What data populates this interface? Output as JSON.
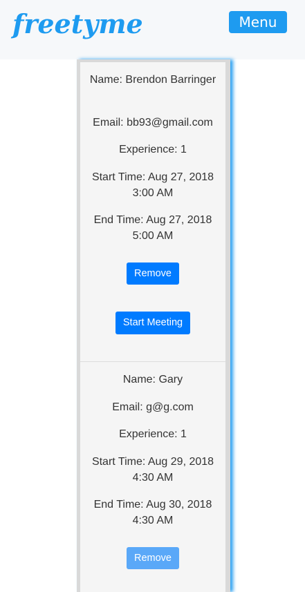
{
  "header": {
    "logo_text": "freetyme",
    "menu_label": "Menu",
    "brand_color": "#1e9bf0"
  },
  "entries": [
    {
      "name": "Name: Brendon Barringer",
      "email": "Email: bb93@gmail.com",
      "experience": "Experience: 1",
      "start_time": "Start Time: Aug 27, 2018 3:00 AM",
      "end_time": "End Time: Aug 27, 2018 5:00 AM",
      "remove_label": "Remove",
      "start_meeting_label": "Start Meeting"
    },
    {
      "name": "Name: Gary",
      "email": "Email: g@g.com",
      "experience": "Experience: 1",
      "start_time": "Start Time: Aug 29, 2018 4:30 AM",
      "end_time": "End Time: Aug 30, 2018 4:30 AM",
      "remove_label": "Remove"
    }
  ],
  "colors": {
    "button": "#007bff",
    "button_faded": "#5aa8f8",
    "card_background": "#f5f5f5"
  }
}
